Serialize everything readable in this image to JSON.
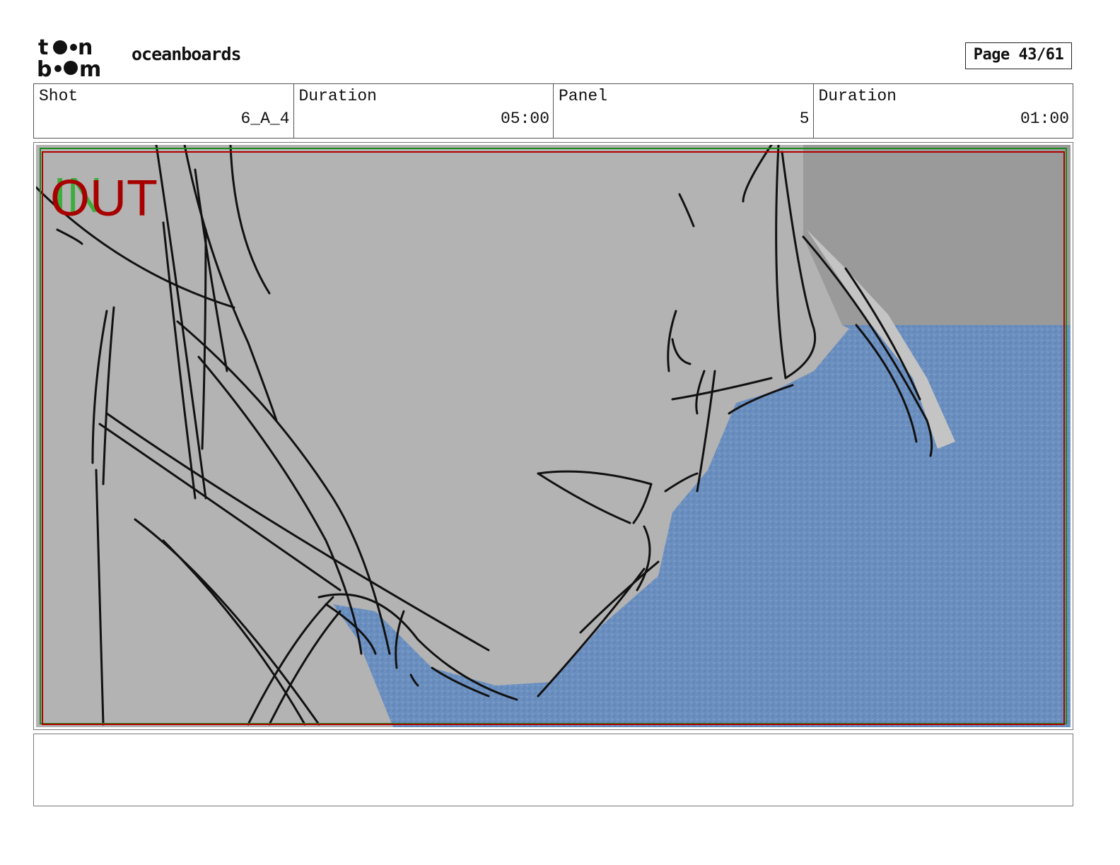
{
  "header": {
    "logo_text_top": "toon",
    "logo_text_bottom": "boom",
    "project": "oceanboards",
    "page": "Page 43/61"
  },
  "info": {
    "shot_label": "Shot",
    "shot_value": "6_A_4",
    "shot_duration_label": "Duration",
    "shot_duration_value": "05:00",
    "panel_label": "Panel",
    "panel_value": "5",
    "panel_duration_label": "Duration",
    "panel_duration_value": "01:00"
  },
  "panel": {
    "marker_in": "IN",
    "marker_out": "OUT",
    "colors": {
      "background_gray": "#b3b3b3",
      "dark_gray": "#9a9a9a",
      "ocean_blue": "#6b8fbf",
      "in_green": "#2fae2f",
      "out_red": "#a80000",
      "frame_red": "#b00000",
      "frame_green": "#1f8a1f"
    }
  },
  "caption": ""
}
